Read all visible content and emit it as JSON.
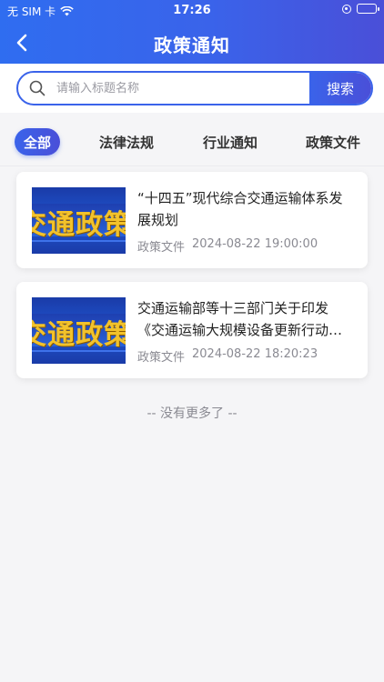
{
  "status_bar": {
    "carrier": "无 SIM 卡",
    "time": "17:26"
  },
  "nav": {
    "title": "政策通知"
  },
  "search": {
    "placeholder": "请输入标题名称",
    "button_label": "搜索"
  },
  "tabs": [
    {
      "label": "全部",
      "active": true
    },
    {
      "label": "法律法规",
      "active": false
    },
    {
      "label": "行业通知",
      "active": false
    },
    {
      "label": "政策文件",
      "active": false
    }
  ],
  "items": [
    {
      "thumb_text": "交通政策",
      "title": "“十四五”现代综合交通运输体系发展规划",
      "category": "政策文件",
      "date": "2024-08-22 19:00:00"
    },
    {
      "thumb_text": "交通政策",
      "title": "交通运输部等十三部门关于印发《交通运输大规模设备更新行动方案》的通知",
      "category": "政策文件",
      "date": "2024-08-22 18:20:23"
    }
  ],
  "footer": {
    "no_more": "--  没有更多了  --"
  },
  "colors": {
    "accent": "#3a63ea",
    "accent_end": "#4a4fd8",
    "background": "#f5f5f7"
  },
  "icons": {
    "back": "chevron-left-icon",
    "search": "search-icon",
    "wifi": "wifi-icon",
    "battery": "battery-icon",
    "lock": "orientation-lock-icon"
  }
}
